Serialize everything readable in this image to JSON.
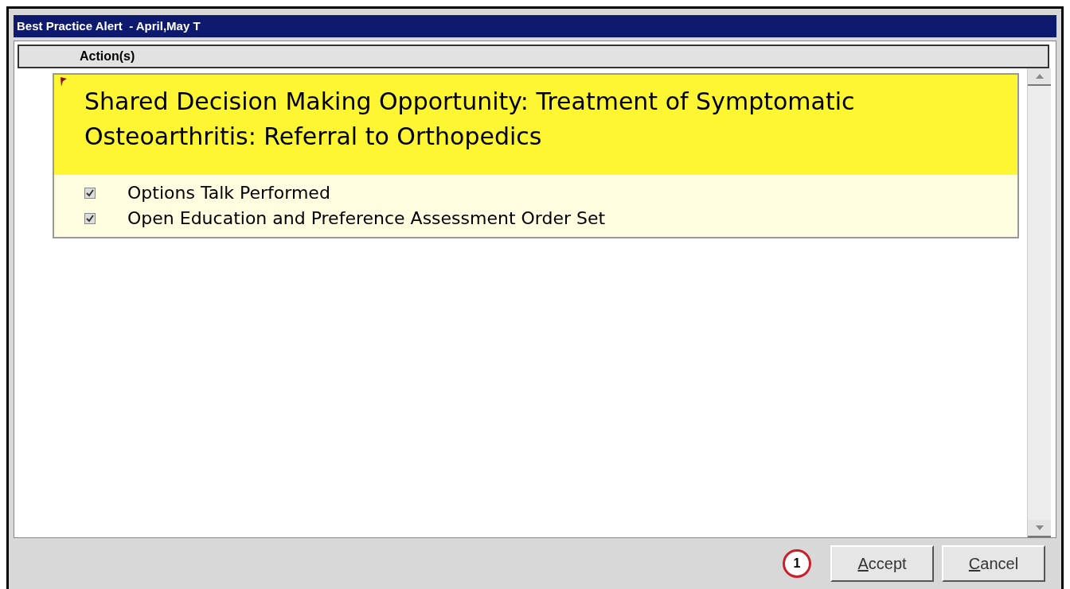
{
  "window": {
    "title": "Best Practice Alert  - April,May T"
  },
  "header": {
    "label": "Action(s)"
  },
  "alert": {
    "flagged": true,
    "title": "Shared Decision Making Opportunity: Treatment of Symptomatic Osteoarthritis: Referral to Orthopedics",
    "actions": [
      {
        "label": "Options Talk Performed",
        "checked": true
      },
      {
        "label": "Open Education and Preference Assessment Order Set",
        "checked": true
      }
    ]
  },
  "callout": "1",
  "buttons": [
    {
      "mnemonic": "A",
      "rest": "ccept"
    },
    {
      "mnemonic": "C",
      "rest": "ancel"
    }
  ]
}
